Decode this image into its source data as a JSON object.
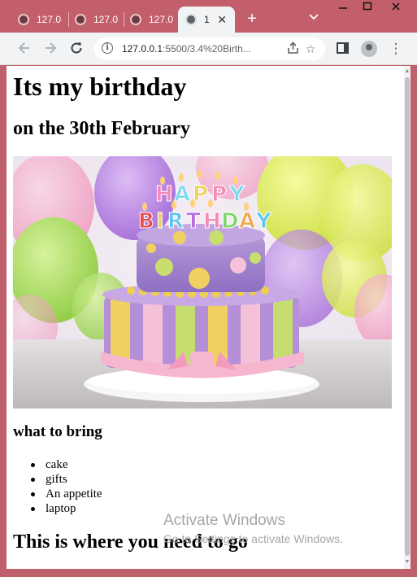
{
  "browser": {
    "tabs": [
      {
        "label": "127.0",
        "active": false
      },
      {
        "label": "127.0",
        "active": false
      },
      {
        "label": "127.0",
        "active": false
      },
      {
        "label": "1",
        "active": true
      }
    ],
    "new_tab_icon": "plus-icon",
    "tab_list_icon": "chevron-down-icon",
    "window_controls": [
      "minimize-icon",
      "maximize-icon",
      "close-icon"
    ],
    "url_host": "127.0.0.1",
    "url_rest": ":5500/3.4%20Birth...",
    "nav_icons": [
      "back-arrow-icon",
      "forward-arrow-icon",
      "reload-icon"
    ],
    "omnibox_icons": [
      "site-info-icon",
      "share-icon",
      "bookmark-star-icon"
    ],
    "toolbar_icons": [
      "side-panel-icon",
      "profile-icon",
      "kebab-menu-icon"
    ]
  },
  "page": {
    "heading": "Its my birthday",
    "subheading": "on the 30th February",
    "image_text": "HAPPY BIRTHDAY",
    "bring_heading": "what to bring",
    "bring_items": [
      "cake",
      "gifts",
      "An appetite",
      "laptop"
    ],
    "location_heading": "This is where you need to go"
  },
  "watermark": {
    "line1": "Activate Windows",
    "line2": "Go to Settings to activate Windows."
  },
  "colors": {
    "frame": "#c25f6b",
    "toolbar": "#f1f3f4",
    "page_background": "#ffffff"
  }
}
